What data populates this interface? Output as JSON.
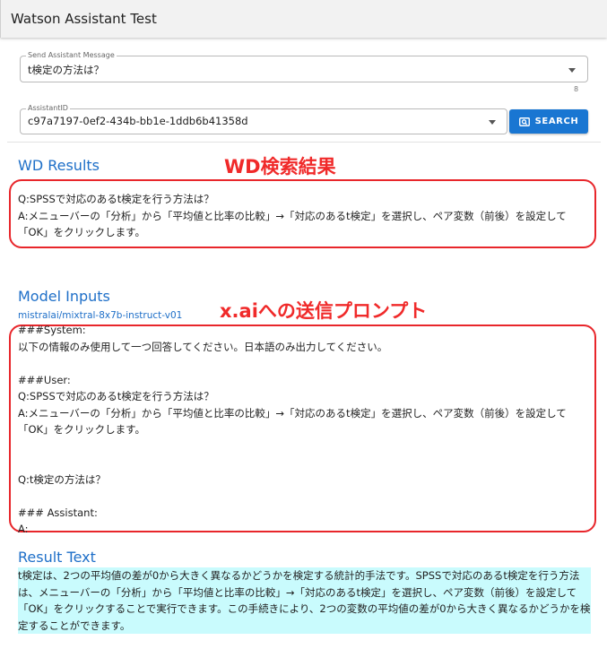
{
  "app": {
    "title": "Watson Assistant Test"
  },
  "message_field": {
    "label": "Send Assistant Message",
    "value": "t検定の方法は？",
    "counter": "8"
  },
  "assistant_field": {
    "label": "AssistantID",
    "value": "c97a7197-0ef2-434b-bb1e-1ddb6b41358d"
  },
  "search_button": {
    "label": "SEARCH",
    "icon": "image-search-icon",
    "color": "#1976d2"
  },
  "wd_results": {
    "title": "WD Results",
    "annotation": "WD検索結果",
    "text": "Q:SPSSで対応のあるt検定を行う方法は？\nA:メニューバーの「分析」から「平均値と比率の比較」→「対応のあるt検定」を選択し、ペア変数（前後）を設定して「OK」をクリックします。"
  },
  "model_inputs": {
    "title": "Model Inputs",
    "annotation": "x.aiへの送信プロンプト",
    "model": "mistralai/mixtral-8x7b-instruct-v01",
    "prompt": "###System:\n以下の情報のみ使用して一つ回答してください。日本語のみ出力してください。\n\n###User:\nQ:SPSSで対応のあるt検定を行う方法は？\nA:メニューバーの「分析」から「平均値と比率の比較」→「対応のあるt検定」を選択し、ペア変数（前後）を設定して「OK」をクリックします。\n\n\nQ:t検定の方法は？\n\n### Assistant:\nA:"
  },
  "result": {
    "title": "Result Text",
    "text": "t検定は、2つの平均値の差が0から大きく異なるかどうかを検定する統計的手法です。SPSSで対応のあるt検定を行う方法は、メニューバーの「分析」から「平均値と比率の比較」→「対応のあるt検定」を選択し、ペア変数（前後）を設定して「OK」をクリックすることで実行できます。この手続きにより、2つの変数の平均値の差が0から大きく異なるかどうかを検定することができます。",
    "highlight_color": "#c9fbfd"
  },
  "colors": {
    "accent": "#1976d2",
    "annotation": "#e8262b"
  }
}
